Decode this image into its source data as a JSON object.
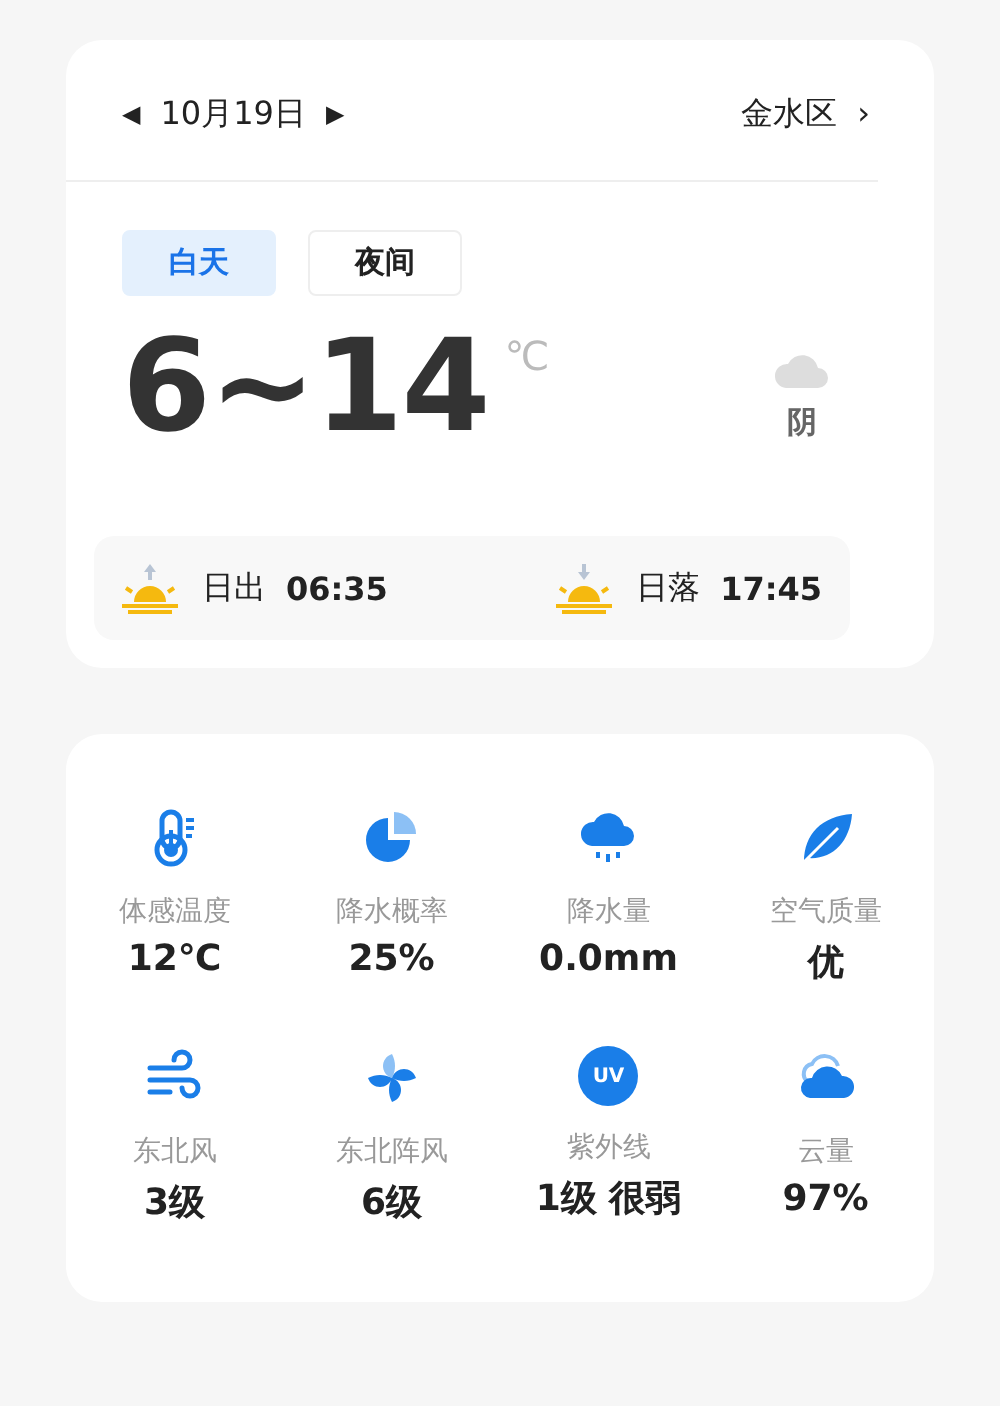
{
  "header": {
    "prev": "◀",
    "date": "10月19日",
    "next": "▶",
    "location": "金水区",
    "location_arrow": "›"
  },
  "tabs": [
    {
      "label": "白天",
      "selected": true
    },
    {
      "label": "夜间",
      "selected": false
    }
  ],
  "temperature": {
    "range": "6~14",
    "unit": "℃"
  },
  "condition": {
    "label": "阴"
  },
  "sun": [
    {
      "kind": "sunrise",
      "label": "日出",
      "time": "06:35"
    },
    {
      "kind": "sunset",
      "label": "日落",
      "time": "17:45"
    }
  ],
  "details": [
    {
      "kind": "thermometer",
      "label": "体感温度",
      "value": "12℃"
    },
    {
      "kind": "pie",
      "label": "降水概率",
      "value": "25%"
    },
    {
      "kind": "rain",
      "label": "降水量",
      "value": "0.0mm"
    },
    {
      "kind": "leaf",
      "label": "空气质量",
      "value": "优"
    },
    {
      "kind": "wind",
      "label": "东北风",
      "value": "3级"
    },
    {
      "kind": "gust",
      "label": "东北阵风",
      "value": "6级"
    },
    {
      "kind": "uv",
      "label": "紫外线",
      "value": "1级 很弱",
      "icon_text": "UV"
    },
    {
      "kind": "cloud",
      "label": "云量",
      "value": "97%"
    }
  ]
}
